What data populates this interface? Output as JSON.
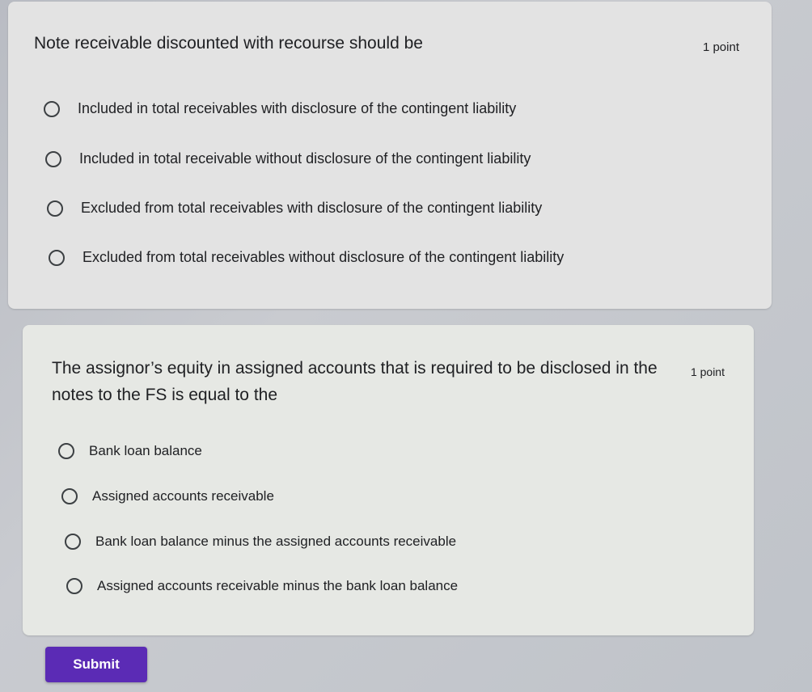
{
  "questions": [
    {
      "text": "Note receivable discounted with recourse should be",
      "points": "1 point",
      "options": [
        "Included in total receivables with disclosure of the contingent liability",
        "Included in total receivable without disclosure of the contingent liability",
        "Excluded from total receivables with disclosure of the contingent liability",
        "Excluded from total receivables without disclosure of the contingent liability"
      ]
    },
    {
      "text": "The assignor’s equity in assigned accounts that is required to be disclosed in the notes to the FS is equal to the",
      "points": "1 point",
      "options": [
        "Bank loan balance",
        "Assigned accounts receivable",
        "Bank loan balance minus the assigned accounts receivable",
        "Assigned accounts receivable minus the bank loan balance"
      ]
    }
  ],
  "submit_label": "Submit",
  "colors": {
    "accent": "#5b2bb5",
    "card_bg": "#e3e3e3",
    "text": "#202124"
  }
}
